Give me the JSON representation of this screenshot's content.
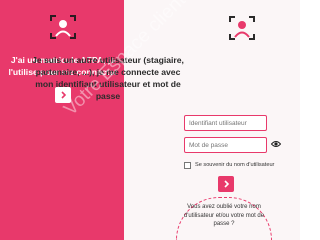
{
  "colors": {
    "accent": "#e8396b",
    "background_right": "#fbf6f7"
  },
  "left": {
    "icon": "user-scan-icon",
    "text": "J'ai un matricule AFPA, je l'utilise pour me connecter",
    "button_icon": "chevron-right-icon"
  },
  "right": {
    "icon": "user-scan-icon",
    "text": "Je suis un autre utilisateur (stagiaire, partenaire, ...), je me connecte avec mon identifiant utilisateur et mot de passe",
    "username_placeholder": "Identifiant utilisateur",
    "password_placeholder": "Mot de passe",
    "eye_icon": "eye-icon",
    "remember_label": "Se souvenir du nom d'utilisateur",
    "button_icon": "chevron-right-icon",
    "forgot_text": "Vous avez oublié votre nom d'utilisateur et/ou votre mot de passe ?"
  },
  "watermark": "Votre Espace client"
}
